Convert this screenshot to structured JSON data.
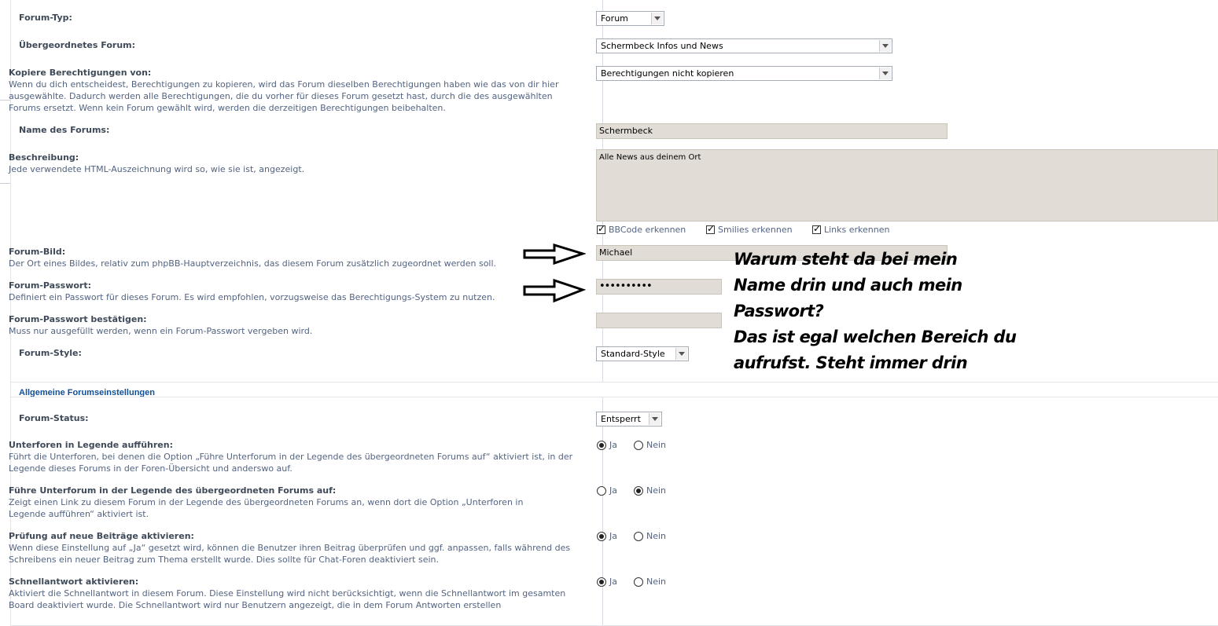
{
  "forum_settings": {
    "forum_type": {
      "label": "Forum-Typ:",
      "value": "Forum"
    },
    "parent_forum": {
      "label": "Übergeordnetes Forum:",
      "value": "Schermbeck Infos und News"
    },
    "copy_permissions": {
      "label": "Kopiere Berechtigungen von:",
      "desc": "Wenn du dich entscheidest, Berechtigungen zu kopieren, wird das Forum dieselben Berechtigungen haben wie das von dir hier ausgewählte. Dadurch werden alle Berechtigungen, die du vorher für dieses Forum gesetzt hast, durch die des ausgewählten Forums ersetzt. Wenn kein Forum gewählt wird, werden die derzeitigen Berechtigungen beibehalten.",
      "value": "Berechtigungen nicht kopieren"
    },
    "forum_name": {
      "label": "Name des Forums:",
      "value": "Schermbeck"
    },
    "description": {
      "label": "Beschreibung:",
      "desc": "Jede verwendete HTML-Auszeichnung wird so, wie sie ist, angezeigt.",
      "value": "Alle News aus deinem Ort",
      "options": [
        {
          "label": "BBCode erkennen",
          "checked": true
        },
        {
          "label": "Smilies erkennen",
          "checked": true
        },
        {
          "label": "Links erkennen",
          "checked": true
        }
      ]
    },
    "forum_image": {
      "label": "Forum-Bild:",
      "desc": "Der Ort eines Bildes, relativ zum phpBB-Hauptverzeichnis, das diesem Forum zusätzlich zugeordnet werden soll.",
      "value": "Michael"
    },
    "forum_password": {
      "label": "Forum-Passwort:",
      "desc": "Definiert ein Passwort für dieses Forum. Es wird empfohlen, vorzugsweise das Berechtigungs-System zu nutzen.",
      "value": "••••••••••"
    },
    "forum_password_confirm": {
      "label": "Forum-Passwort bestätigen:",
      "desc": "Muss nur ausgefüllt werden, wenn ein Forum-Passwort vergeben wird.",
      "value": ""
    },
    "forum_style": {
      "label": "Forum-Style:",
      "value": "Standard-Style"
    }
  },
  "general_settings": {
    "title": "Allgemeine Forumseinstellungen",
    "yes_label": "Ja",
    "no_label": "Nein",
    "forum_status": {
      "label": "Forum-Status:",
      "value": "Entsperrt"
    },
    "rows": [
      {
        "label": "Unterforen in Legende aufführen:",
        "desc": "Führt die Unterforen, bei denen die Option „Führe Unterforum in der Legende des übergeordneten Forums auf“ aktiviert ist, in der Legende dieses Forums in der Foren-Übersicht und anderswo auf.",
        "selected": "Ja"
      },
      {
        "label": "Führe Unterforum in der Legende des übergeordneten Forums auf:",
        "desc": "Zeigt einen Link zu diesem Forum in der Legende des übergeordneten Forums an, wenn dort die Option „Unterforen in Legende aufführen“ aktiviert ist.",
        "selected": "Nein"
      },
      {
        "label": "Prüfung auf neue Beiträge aktivieren:",
        "desc": "Wenn diese Einstellung auf „Ja“ gesetzt wird, können die Benutzer ihren Beitrag überprüfen und ggf. anpassen, falls während des Schreibens ein neuer Beitrag zum Thema erstellt wurde. Dies sollte für Chat-Foren deaktiviert sein.",
        "selected": "Ja"
      },
      {
        "label": "Schnellantwort aktivieren:",
        "desc": "Aktiviert die Schnellantwort in diesem Forum. Diese Einstellung wird nicht berücksichtigt, wenn die Schnellantwort im gesamten Board deaktiviert wurde. Die Schnellantwort wird nur Benutzern angezeigt, die in dem Forum Antworten erstellen",
        "selected": "Ja"
      }
    ]
  },
  "annotation": {
    "lines": [
      "Warum steht da bei mein",
      "Name drin und auch mein",
      "Passwort?",
      "Das ist egal welchen Bereich du",
      "aufrufst. Steht immer drin"
    ]
  }
}
